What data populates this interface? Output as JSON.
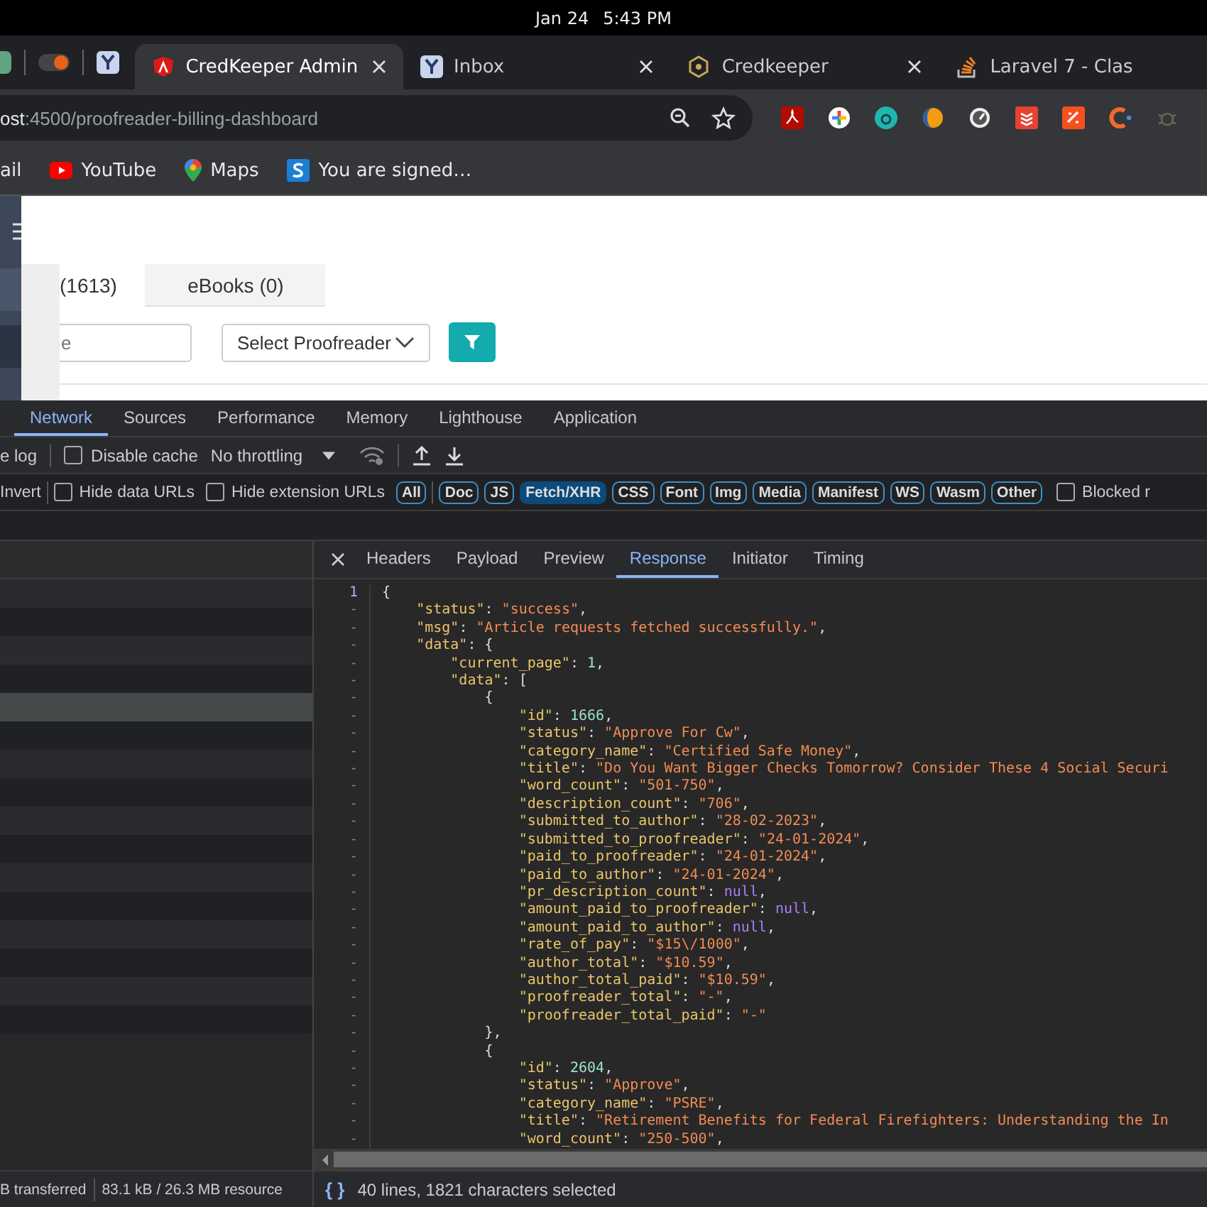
{
  "system_bar": {
    "date": "Jan 24",
    "time": "5:43 PM"
  },
  "browser": {
    "tabs": [
      {
        "title": "CredKeeper Admin",
        "kind": "angular",
        "selected": true
      },
      {
        "title": "Inbox",
        "kind": "mail",
        "selected": false
      },
      {
        "title": "Credkeeper",
        "kind": "hex",
        "selected": false
      },
      {
        "title": "Laravel 7 - Clas",
        "kind": "stack",
        "selected": false
      }
    ],
    "address": {
      "host": "ost",
      "path": ":4500/proofreader-billing-dashboard"
    },
    "bookmarks": [
      {
        "label": "ail",
        "kind": "plain"
      },
      {
        "label": "YouTube",
        "kind": "video"
      },
      {
        "label": "Maps",
        "kind": "pin"
      },
      {
        "label": "You are signed…",
        "kind": "badge"
      }
    ]
  },
  "page": {
    "tabs": [
      {
        "label": "(1613)",
        "selected": true
      },
      {
        "label": "eBooks (0)",
        "selected": false
      }
    ],
    "search": {
      "placeholder": "e"
    },
    "proofreader_select": {
      "value": "Select Proofreader"
    }
  },
  "devtools": {
    "tabs": [
      {
        "label": "Network",
        "selected": true
      },
      {
        "label": "Sources",
        "selected": false
      },
      {
        "label": "Performance",
        "selected": false
      },
      {
        "label": "Memory",
        "selected": false
      },
      {
        "label": "Lighthouse",
        "selected": false
      },
      {
        "label": "Application",
        "selected": false
      }
    ],
    "toolbar": {
      "preserve_log": "e log",
      "disable_cache": {
        "label": "Disable cache",
        "checked": false
      },
      "throttling": "No throttling"
    },
    "invert": "Invert",
    "filter_checks": [
      {
        "label": "Hide data URLs",
        "checked": false
      },
      {
        "label": "Hide extension URLs",
        "checked": false
      }
    ],
    "filters": [
      {
        "label": "All",
        "selected": false
      },
      {
        "label": "Doc",
        "selected": false
      },
      {
        "label": "JS",
        "selected": false
      },
      {
        "label": "Fetch/XHR",
        "selected": true
      },
      {
        "label": "CSS",
        "selected": false
      },
      {
        "label": "Font",
        "selected": false
      },
      {
        "label": "Img",
        "selected": false
      },
      {
        "label": "Media",
        "selected": false
      },
      {
        "label": "Manifest",
        "selected": false
      },
      {
        "label": "WS",
        "selected": false
      },
      {
        "label": "Wasm",
        "selected": false
      },
      {
        "label": "Other",
        "selected": false
      }
    ],
    "blocked": {
      "label": "Blocked r",
      "checked": false
    },
    "requests": [
      {
        "selected": false
      },
      {
        "selected": false
      },
      {
        "selected": false
      },
      {
        "selected": false
      },
      {
        "selected": true
      },
      {
        "selected": false
      },
      {
        "selected": false
      },
      {
        "selected": false
      },
      {
        "selected": false
      },
      {
        "selected": false
      },
      {
        "selected": false
      },
      {
        "selected": false
      },
      {
        "selected": false
      },
      {
        "selected": false
      },
      {
        "selected": false
      },
      {
        "selected": false
      }
    ],
    "detail_tabs": [
      {
        "label": "Headers",
        "selected": false
      },
      {
        "label": "Payload",
        "selected": false
      },
      {
        "label": "Preview",
        "selected": false
      },
      {
        "label": "Response",
        "selected": true
      },
      {
        "label": "Initiator",
        "selected": false
      },
      {
        "label": "Timing",
        "selected": false
      }
    ],
    "response_lines": [
      {
        "num": "1",
        "tokens": [
          {
            "kind": "punct",
            "text": "{"
          }
        ]
      },
      {
        "num": "-",
        "tokens": [
          {
            "kind": "key",
            "text": "    \"status\""
          },
          {
            "kind": "punct",
            "text": ": "
          },
          {
            "kind": "string",
            "text": "\"success\""
          },
          {
            "kind": "punct",
            "text": ","
          }
        ]
      },
      {
        "num": "-",
        "tokens": [
          {
            "kind": "key",
            "text": "    \"msg\""
          },
          {
            "kind": "punct",
            "text": ": "
          },
          {
            "kind": "string",
            "text": "\"Article requests fetched successfully.\""
          },
          {
            "kind": "punct",
            "text": ","
          }
        ]
      },
      {
        "num": "-",
        "tokens": [
          {
            "kind": "key",
            "text": "    \"data\""
          },
          {
            "kind": "punct",
            "text": ": {"
          }
        ]
      },
      {
        "num": "-",
        "tokens": [
          {
            "kind": "key",
            "text": "        \"current_page\""
          },
          {
            "kind": "punct",
            "text": ": "
          },
          {
            "kind": "number",
            "text": "1"
          },
          {
            "kind": "punct",
            "text": ","
          }
        ]
      },
      {
        "num": "-",
        "tokens": [
          {
            "kind": "key",
            "text": "        \"data\""
          },
          {
            "kind": "punct",
            "text": ": ["
          }
        ]
      },
      {
        "num": "-",
        "tokens": [
          {
            "kind": "punct",
            "text": "            {"
          }
        ]
      },
      {
        "num": "-",
        "tokens": [
          {
            "kind": "key",
            "text": "                \"id\""
          },
          {
            "kind": "punct",
            "text": ": "
          },
          {
            "kind": "number",
            "text": "1666"
          },
          {
            "kind": "punct",
            "text": ","
          }
        ]
      },
      {
        "num": "-",
        "tokens": [
          {
            "kind": "key",
            "text": "                \"status\""
          },
          {
            "kind": "punct",
            "text": ": "
          },
          {
            "kind": "string",
            "text": "\"Approve For Cw\""
          },
          {
            "kind": "punct",
            "text": ","
          }
        ]
      },
      {
        "num": "-",
        "tokens": [
          {
            "kind": "key",
            "text": "                \"category_name\""
          },
          {
            "kind": "punct",
            "text": ": "
          },
          {
            "kind": "string",
            "text": "\"Certified Safe Money\""
          },
          {
            "kind": "punct",
            "text": ","
          }
        ]
      },
      {
        "num": "-",
        "tokens": [
          {
            "kind": "key",
            "text": "                \"title\""
          },
          {
            "kind": "punct",
            "text": ": "
          },
          {
            "kind": "string",
            "text": "\"Do You Want Bigger Checks Tomorrow? Consider These 4 Social Securi"
          }
        ]
      },
      {
        "num": "-",
        "tokens": [
          {
            "kind": "key",
            "text": "                \"word_count\""
          },
          {
            "kind": "punct",
            "text": ": "
          },
          {
            "kind": "string",
            "text": "\"501-750\""
          },
          {
            "kind": "punct",
            "text": ","
          }
        ]
      },
      {
        "num": "-",
        "tokens": [
          {
            "kind": "key",
            "text": "                \"description_count\""
          },
          {
            "kind": "punct",
            "text": ": "
          },
          {
            "kind": "string",
            "text": "\"706\""
          },
          {
            "kind": "punct",
            "text": ","
          }
        ]
      },
      {
        "num": "-",
        "tokens": [
          {
            "kind": "key",
            "text": "                \"submitted_to_author\""
          },
          {
            "kind": "punct",
            "text": ": "
          },
          {
            "kind": "string",
            "text": "\"28-02-2023\""
          },
          {
            "kind": "punct",
            "text": ","
          }
        ]
      },
      {
        "num": "-",
        "tokens": [
          {
            "kind": "key",
            "text": "                \"submitted_to_proofreader\""
          },
          {
            "kind": "punct",
            "text": ": "
          },
          {
            "kind": "string",
            "text": "\"24-01-2024\""
          },
          {
            "kind": "punct",
            "text": ","
          }
        ]
      },
      {
        "num": "-",
        "tokens": [
          {
            "kind": "key",
            "text": "                \"paid_to_proofreader\""
          },
          {
            "kind": "punct",
            "text": ": "
          },
          {
            "kind": "string",
            "text": "\"24-01-2024\""
          },
          {
            "kind": "punct",
            "text": ","
          }
        ]
      },
      {
        "num": "-",
        "tokens": [
          {
            "kind": "key",
            "text": "                \"paid_to_author\""
          },
          {
            "kind": "punct",
            "text": ": "
          },
          {
            "kind": "string",
            "text": "\"24-01-2024\""
          },
          {
            "kind": "punct",
            "text": ","
          }
        ]
      },
      {
        "num": "-",
        "tokens": [
          {
            "kind": "key",
            "text": "                \"pr_description_count\""
          },
          {
            "kind": "punct",
            "text": ": "
          },
          {
            "kind": "null",
            "text": "null"
          },
          {
            "kind": "punct",
            "text": ","
          }
        ]
      },
      {
        "num": "-",
        "tokens": [
          {
            "kind": "key",
            "text": "                \"amount_paid_to_proofreader\""
          },
          {
            "kind": "punct",
            "text": ": "
          },
          {
            "kind": "null",
            "text": "null"
          },
          {
            "kind": "punct",
            "text": ","
          }
        ]
      },
      {
        "num": "-",
        "tokens": [
          {
            "kind": "key",
            "text": "                \"amount_paid_to_author\""
          },
          {
            "kind": "punct",
            "text": ": "
          },
          {
            "kind": "null",
            "text": "null"
          },
          {
            "kind": "punct",
            "text": ","
          }
        ]
      },
      {
        "num": "-",
        "tokens": [
          {
            "kind": "key",
            "text": "                \"rate_of_pay\""
          },
          {
            "kind": "punct",
            "text": ": "
          },
          {
            "kind": "string",
            "text": "\"$15\\/1000\""
          },
          {
            "kind": "punct",
            "text": ","
          }
        ]
      },
      {
        "num": "-",
        "tokens": [
          {
            "kind": "key",
            "text": "                \"author_total\""
          },
          {
            "kind": "punct",
            "text": ": "
          },
          {
            "kind": "string",
            "text": "\"$10.59\""
          },
          {
            "kind": "punct",
            "text": ","
          }
        ]
      },
      {
        "num": "-",
        "tokens": [
          {
            "kind": "key",
            "text": "                \"author_total_paid\""
          },
          {
            "kind": "punct",
            "text": ": "
          },
          {
            "kind": "string",
            "text": "\"$10.59\""
          },
          {
            "kind": "punct",
            "text": ","
          }
        ]
      },
      {
        "num": "-",
        "tokens": [
          {
            "kind": "key",
            "text": "                \"proofreader_total\""
          },
          {
            "kind": "punct",
            "text": ": "
          },
          {
            "kind": "string",
            "text": "\"-\""
          },
          {
            "kind": "punct",
            "text": ","
          }
        ]
      },
      {
        "num": "-",
        "tokens": [
          {
            "kind": "key",
            "text": "                \"proofreader_total_paid\""
          },
          {
            "kind": "punct",
            "text": ": "
          },
          {
            "kind": "string",
            "text": "\"-\""
          }
        ]
      },
      {
        "num": "-",
        "tokens": [
          {
            "kind": "punct",
            "text": "            },"
          }
        ]
      },
      {
        "num": "-",
        "tokens": [
          {
            "kind": "punct",
            "text": "            {"
          }
        ]
      },
      {
        "num": "-",
        "tokens": [
          {
            "kind": "key",
            "text": "                \"id\""
          },
          {
            "kind": "punct",
            "text": ": "
          },
          {
            "kind": "number",
            "text": "2604"
          },
          {
            "kind": "punct",
            "text": ","
          }
        ]
      },
      {
        "num": "-",
        "tokens": [
          {
            "kind": "key",
            "text": "                \"status\""
          },
          {
            "kind": "punct",
            "text": ": "
          },
          {
            "kind": "string",
            "text": "\"Approve\""
          },
          {
            "kind": "punct",
            "text": ","
          }
        ]
      },
      {
        "num": "-",
        "tokens": [
          {
            "kind": "key",
            "text": "                \"category_name\""
          },
          {
            "kind": "punct",
            "text": ": "
          },
          {
            "kind": "string",
            "text": "\"PSRE\""
          },
          {
            "kind": "punct",
            "text": ","
          }
        ]
      },
      {
        "num": "-",
        "tokens": [
          {
            "kind": "key",
            "text": "                \"title\""
          },
          {
            "kind": "punct",
            "text": ": "
          },
          {
            "kind": "string",
            "text": "\"Retirement Benefits for Federal Firefighters: Understanding the In"
          }
        ]
      },
      {
        "num": "-",
        "tokens": [
          {
            "kind": "key",
            "text": "                \"word_count\""
          },
          {
            "kind": "punct",
            "text": ": "
          },
          {
            "kind": "string",
            "text": "\"250-500\""
          },
          {
            "kind": "punct",
            "text": ","
          }
        ]
      }
    ],
    "status_left": {
      "transferred": "B transferred",
      "resources": "83.1 kB / 26.3 MB resource"
    },
    "status_right": {
      "format_icon": "{ }",
      "selection": "40 lines, 1821 characters selected"
    }
  }
}
